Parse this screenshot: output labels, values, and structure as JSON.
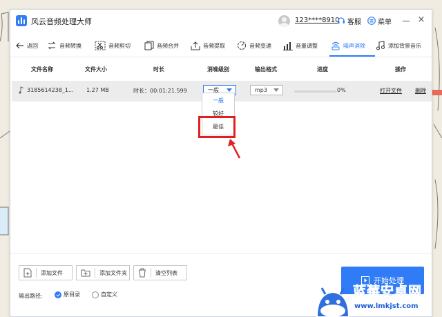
{
  "app": {
    "title": "风云音频处理大师",
    "account": "123****8910",
    "support_label": "客服",
    "menu_label": "菜单"
  },
  "toolbar": {
    "back": "返回",
    "items": [
      {
        "label": "音频转换",
        "icon": "convert-icon"
      },
      {
        "label": "音频剪切",
        "icon": "scissors-icon"
      },
      {
        "label": "音频合并",
        "icon": "merge-icon"
      },
      {
        "label": "音频提取",
        "icon": "extract-icon"
      },
      {
        "label": "音频变速",
        "icon": "speed-icon"
      },
      {
        "label": "音量调整",
        "icon": "volume-bars-icon"
      },
      {
        "label": "噪声消除",
        "icon": "noise-icon",
        "active": true
      },
      {
        "label": "添加背景音乐",
        "icon": "music-note-icon"
      }
    ]
  },
  "table": {
    "headers": [
      "文件名称",
      "文件大小",
      "时长",
      "消噪级别",
      "输出格式",
      "进度",
      "操作"
    ],
    "row": {
      "filename": "3185614238_1...",
      "size": "1.27 MB",
      "duration": "时长：00:01:21.599",
      "noise_level": "一般",
      "format": "mp3",
      "progress_text": "0%",
      "progress": 0,
      "open_file": "打开文件",
      "delete": "删除"
    }
  },
  "dropdown": {
    "options": [
      "一般",
      "较好",
      "最佳"
    ],
    "selected": "一般",
    "highlighted": "最佳"
  },
  "bottom": {
    "add_file": "添加文件",
    "add_folder": "添加文件夹",
    "clear_list": "清空列表",
    "output_path_label": "输出路径:",
    "radio_original": "原目录",
    "radio_custom": "自定义",
    "start": "开始处理"
  },
  "watermark": {
    "title": "蓝莓安卓网",
    "url": "www.lmkjst.com"
  },
  "colors": {
    "accent": "#2f7cf6",
    "highlight": "#e02020"
  }
}
